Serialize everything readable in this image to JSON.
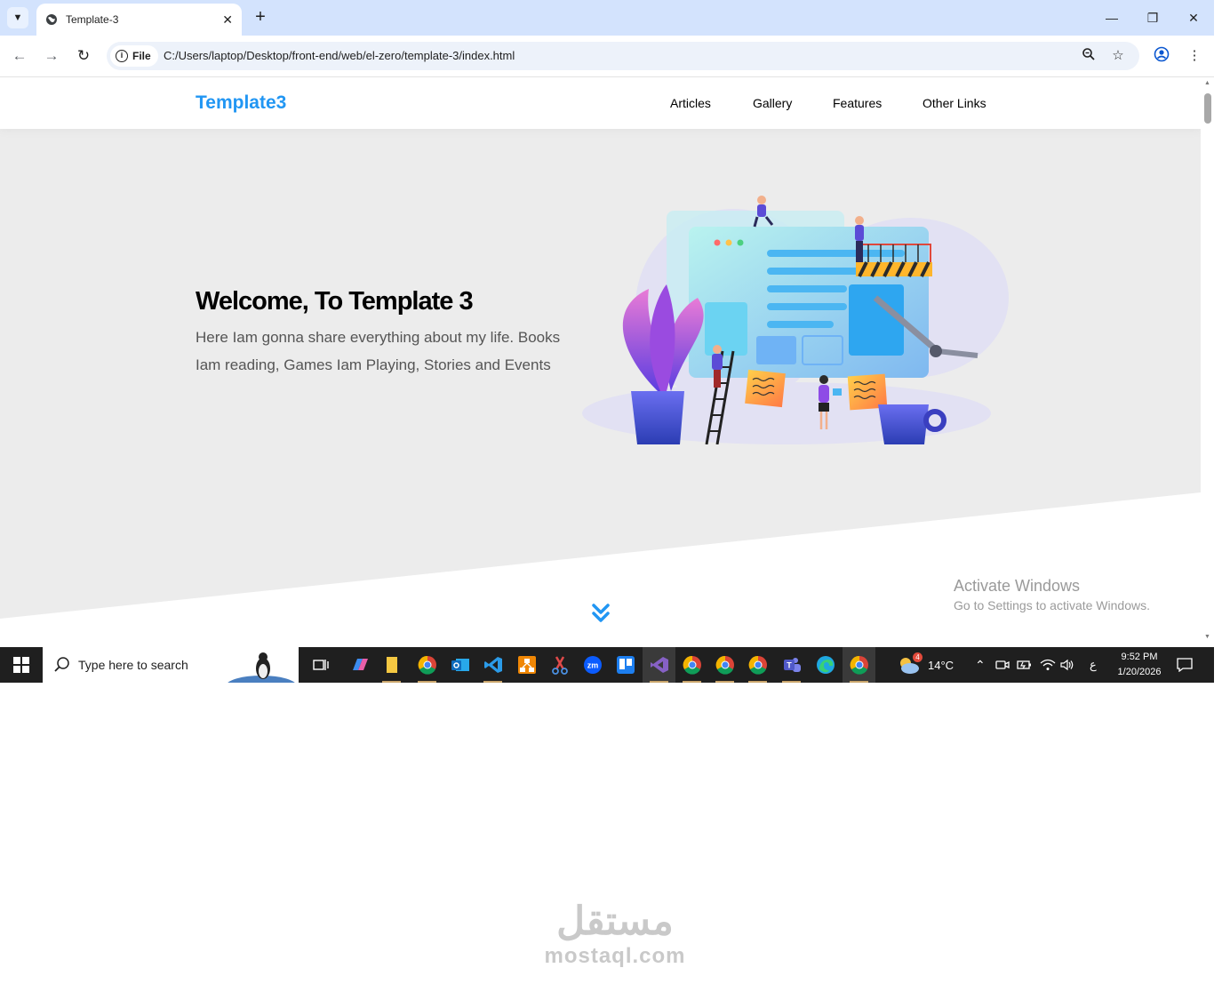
{
  "browser": {
    "tab_title": "Template-3",
    "file_label": "File",
    "url": "C:/Users/laptop/Desktop/front-end/web/el-zero/template-3/index.html"
  },
  "site": {
    "logo": "Template3",
    "nav": [
      {
        "label": "Articles"
      },
      {
        "label": "Gallery"
      },
      {
        "label": "Features"
      },
      {
        "label": "Other Links"
      }
    ],
    "hero": {
      "title": "Welcome, To Template 3",
      "description": "Here Iam gonna share everything about my life. Books Iam reading, Games Iam Playing, Stories and Events"
    },
    "accent_color": "#2196f3"
  },
  "windows_watermark": {
    "line1": "Activate Windows",
    "line2": "Go to Settings to activate Windows."
  },
  "taskbar": {
    "search_placeholder": "Type here to search",
    "weather": "14°C",
    "weather_badge": "4",
    "language": "ع",
    "time": "9:52 PM",
    "date": "1/20/2026"
  },
  "footer_brand": {
    "arabic": "مستقل",
    "latin": "mostaql.com"
  }
}
